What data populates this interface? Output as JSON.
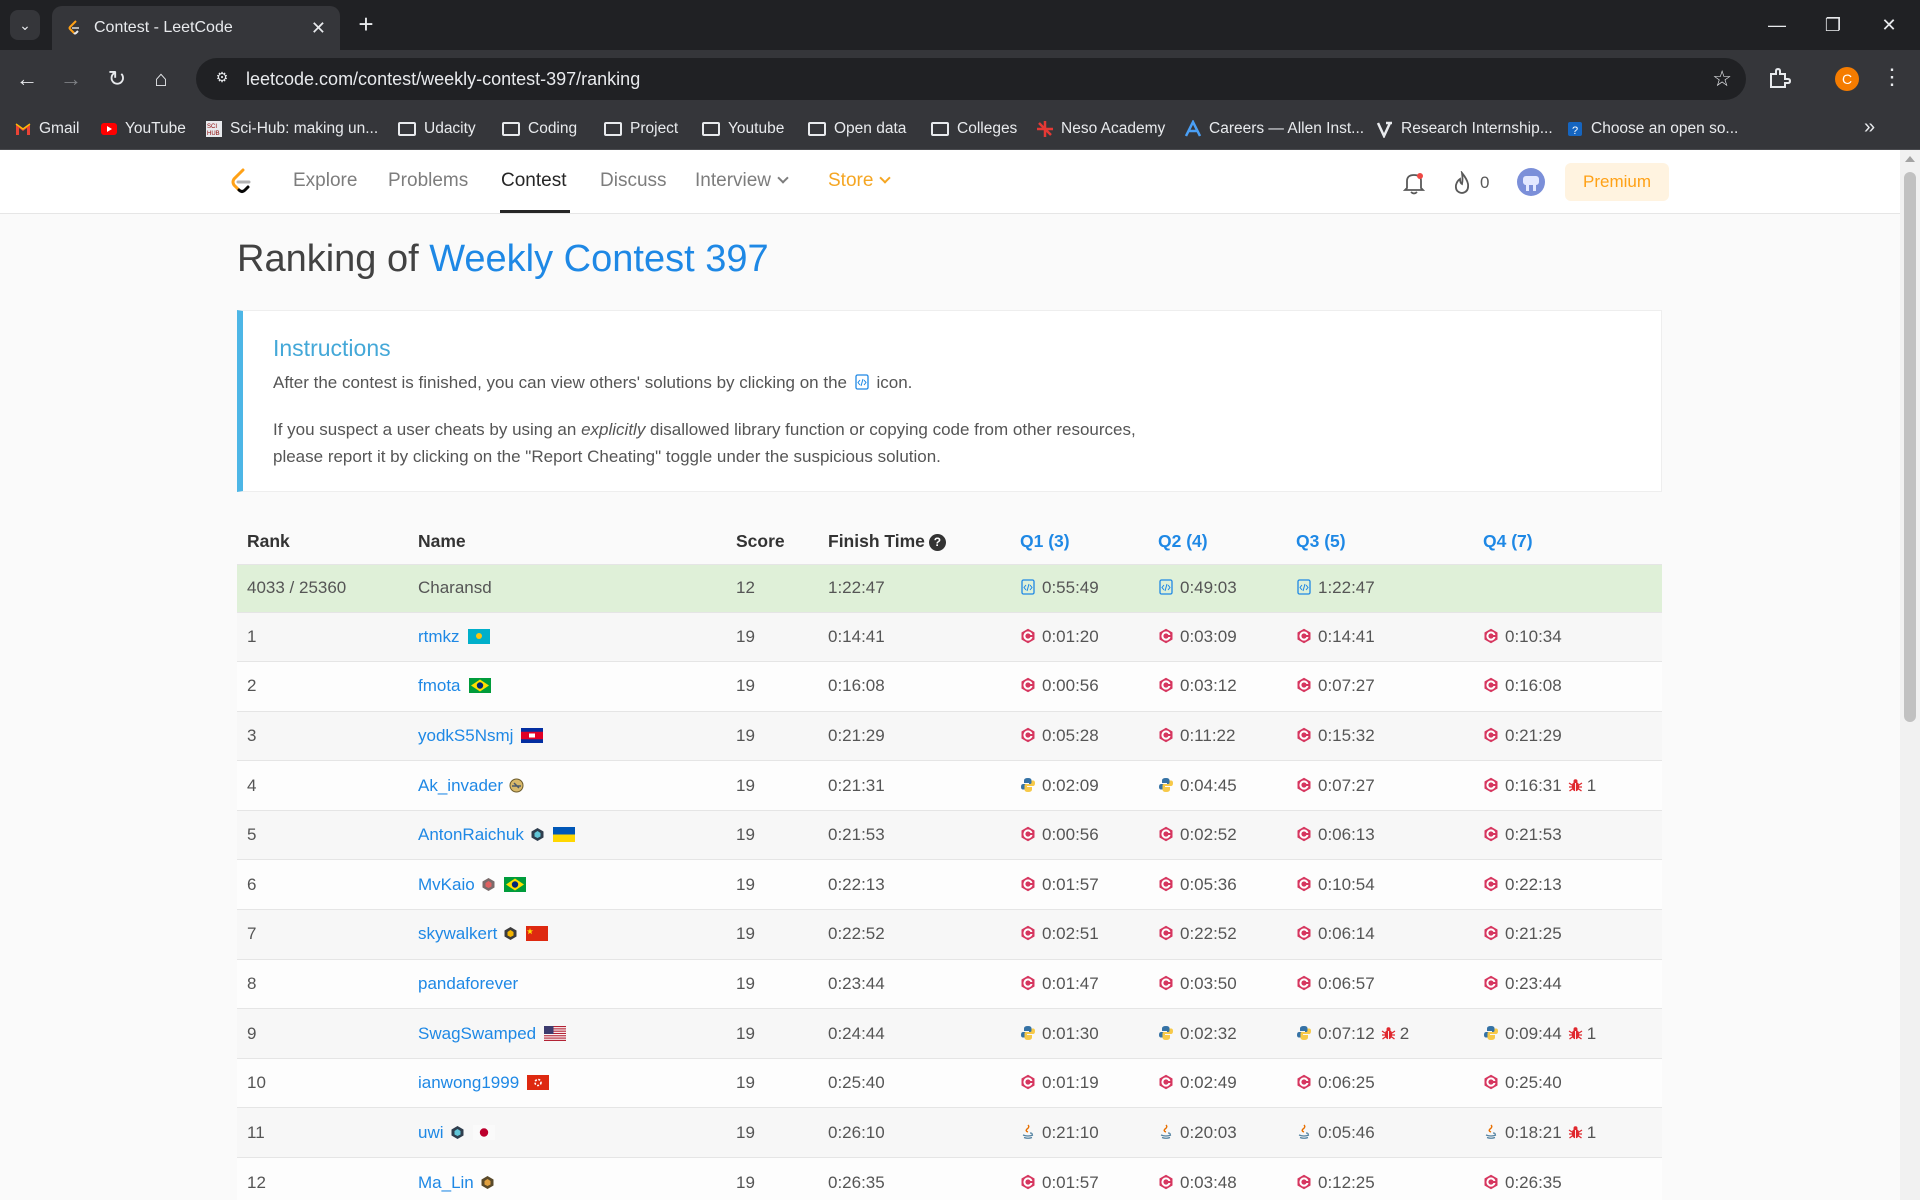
{
  "browser": {
    "tab_title": "Contest - LeetCode",
    "url": "leetcode.com/contest/weekly-contest-397/ranking",
    "profile_initial": "C",
    "bookmarks": [
      {
        "label": "Gmail",
        "icon": "gmail-icon"
      },
      {
        "label": "YouTube",
        "icon": "youtube-icon"
      },
      {
        "label": "Sci-Hub: making un...",
        "icon": "scihub-icon"
      },
      {
        "label": "Udacity",
        "icon": "folder-icon"
      },
      {
        "label": "Coding",
        "icon": "folder-icon"
      },
      {
        "label": "Project",
        "icon": "folder-icon"
      },
      {
        "label": "Youtube",
        "icon": "folder-icon"
      },
      {
        "label": "Open data",
        "icon": "folder-icon"
      },
      {
        "label": "Colleges",
        "icon": "folder-icon"
      },
      {
        "label": "Neso Academy",
        "icon": "neso-icon"
      },
      {
        "label": "Careers — Allen Inst...",
        "icon": "allen-icon"
      },
      {
        "label": "Research Internship...",
        "icon": "research-icon"
      },
      {
        "label": "Choose an open so...",
        "icon": "help-icon"
      }
    ]
  },
  "nav": {
    "explore": "Explore",
    "problems": "Problems",
    "contest": "Contest",
    "discuss": "Discuss",
    "interview": "Interview",
    "store": "Store",
    "streak": "0",
    "premium": "Premium"
  },
  "heading": {
    "prefix": "Ranking of ",
    "contest_name": "Weekly Contest 397"
  },
  "instructions": {
    "title": "Instructions",
    "p1_before": "After the contest is finished, you can view others' solutions by clicking on the",
    "p1_after": "icon.",
    "p2_a": "If you suspect a user cheats by using an ",
    "p2_em": "explicitly",
    "p2_b": " disallowed library function or copying code from other resources,",
    "p2_c": "please report it by clicking on the \"Report Cheating\" toggle under the suspicious solution."
  },
  "table": {
    "headers": {
      "rank": "Rank",
      "name": "Name",
      "score": "Score",
      "finish": "Finish Time",
      "q1": "Q1 (3)",
      "q2": "Q2 (4)",
      "q3": "Q3 (5)",
      "q4": "Q4 (7)"
    },
    "self": {
      "rank": "4033 / 25360",
      "name": "Charansd",
      "score": "12",
      "finish": "1:22:47",
      "q1": "0:55:49",
      "q2": "0:49:03",
      "q3": "1:22:47"
    },
    "rows": [
      {
        "rank": "1",
        "name": "rtmkz",
        "badge": "",
        "flag": "kz",
        "score": "19",
        "finish": "0:14:41",
        "q": [
          {
            "t": "0:01:20",
            "lang": "cpp"
          },
          {
            "t": "0:03:09",
            "lang": "cpp"
          },
          {
            "t": "0:14:41",
            "lang": "cpp"
          },
          {
            "t": "0:10:34",
            "lang": "cpp"
          }
        ]
      },
      {
        "rank": "2",
        "name": "fmota",
        "badge": "",
        "flag": "br",
        "score": "19",
        "finish": "0:16:08",
        "q": [
          {
            "t": "0:00:56",
            "lang": "cpp"
          },
          {
            "t": "0:03:12",
            "lang": "cpp"
          },
          {
            "t": "0:07:27",
            "lang": "cpp"
          },
          {
            "t": "0:16:08",
            "lang": "cpp"
          }
        ]
      },
      {
        "rank": "3",
        "name": "yodkS5Nsmj",
        "badge": "",
        "flag": "kh",
        "score": "19",
        "finish": "0:21:29",
        "q": [
          {
            "t": "0:05:28",
            "lang": "cpp"
          },
          {
            "t": "0:11:22",
            "lang": "cpp"
          },
          {
            "t": "0:15:32",
            "lang": "cpp"
          },
          {
            "t": "0:21:29",
            "lang": "cpp"
          }
        ]
      },
      {
        "rank": "4",
        "name": "Ak_invader",
        "badge": "guardian",
        "flag": "",
        "score": "19",
        "finish": "0:21:31",
        "q": [
          {
            "t": "0:02:09",
            "lang": "py"
          },
          {
            "t": "0:04:45",
            "lang": "py"
          },
          {
            "t": "0:07:27",
            "lang": "cpp"
          },
          {
            "t": "0:16:31",
            "lang": "cpp",
            "bugs": "1"
          }
        ]
      },
      {
        "rank": "5",
        "name": "AntonRaichuk",
        "badge": "knight",
        "flag": "ua",
        "score": "19",
        "finish": "0:21:53",
        "q": [
          {
            "t": "0:00:56",
            "lang": "cpp"
          },
          {
            "t": "0:02:52",
            "lang": "cpp"
          },
          {
            "t": "0:06:13",
            "lang": "cpp"
          },
          {
            "t": "0:21:53",
            "lang": "cpp"
          }
        ]
      },
      {
        "rank": "6",
        "name": "MvKaio",
        "badge": "knight2",
        "flag": "br",
        "score": "19",
        "finish": "0:22:13",
        "q": [
          {
            "t": "0:01:57",
            "lang": "cpp"
          },
          {
            "t": "0:05:36",
            "lang": "cpp"
          },
          {
            "t": "0:10:54",
            "lang": "cpp"
          },
          {
            "t": "0:22:13",
            "lang": "cpp"
          }
        ]
      },
      {
        "rank": "7",
        "name": "skywalkert",
        "badge": "guardian2",
        "flag": "cn",
        "score": "19",
        "finish": "0:22:52",
        "q": [
          {
            "t": "0:02:51",
            "lang": "cpp"
          },
          {
            "t": "0:22:52",
            "lang": "cpp"
          },
          {
            "t": "0:06:14",
            "lang": "cpp"
          },
          {
            "t": "0:21:25",
            "lang": "cpp"
          }
        ]
      },
      {
        "rank": "8",
        "name": "pandaforever",
        "badge": "",
        "flag": "",
        "score": "19",
        "finish": "0:23:44",
        "q": [
          {
            "t": "0:01:47",
            "lang": "cpp"
          },
          {
            "t": "0:03:50",
            "lang": "cpp"
          },
          {
            "t": "0:06:57",
            "lang": "cpp"
          },
          {
            "t": "0:23:44",
            "lang": "cpp"
          }
        ]
      },
      {
        "rank": "9",
        "name": "SwagSwamped",
        "badge": "",
        "flag": "us",
        "score": "19",
        "finish": "0:24:44",
        "q": [
          {
            "t": "0:01:30",
            "lang": "py"
          },
          {
            "t": "0:02:32",
            "lang": "py"
          },
          {
            "t": "0:07:12",
            "lang": "py",
            "bugs": "2"
          },
          {
            "t": "0:09:44",
            "lang": "py",
            "bugs": "1"
          }
        ]
      },
      {
        "rank": "10",
        "name": "ianwong1999",
        "badge": "",
        "flag": "hk",
        "score": "19",
        "finish": "0:25:40",
        "q": [
          {
            "t": "0:01:19",
            "lang": "cpp"
          },
          {
            "t": "0:02:49",
            "lang": "cpp"
          },
          {
            "t": "0:06:25",
            "lang": "cpp"
          },
          {
            "t": "0:25:40",
            "lang": "cpp"
          }
        ]
      },
      {
        "rank": "11",
        "name": "uwi",
        "badge": "knight",
        "flag": "jp",
        "score": "19",
        "finish": "0:26:10",
        "q": [
          {
            "t": "0:21:10",
            "lang": "java"
          },
          {
            "t": "0:20:03",
            "lang": "java"
          },
          {
            "t": "0:05:46",
            "lang": "java"
          },
          {
            "t": "0:18:21",
            "lang": "java",
            "bugs": "1"
          }
        ]
      },
      {
        "rank": "12",
        "name": "Ma_Lin",
        "badge": "guardian3",
        "flag": "",
        "score": "19",
        "finish": "0:26:35",
        "q": [
          {
            "t": "0:01:57",
            "lang": "cpp"
          },
          {
            "t": "0:03:48",
            "lang": "cpp"
          },
          {
            "t": "0:12:25",
            "lang": "cpp"
          },
          {
            "t": "0:26:35",
            "lang": "cpp"
          }
        ]
      }
    ]
  }
}
